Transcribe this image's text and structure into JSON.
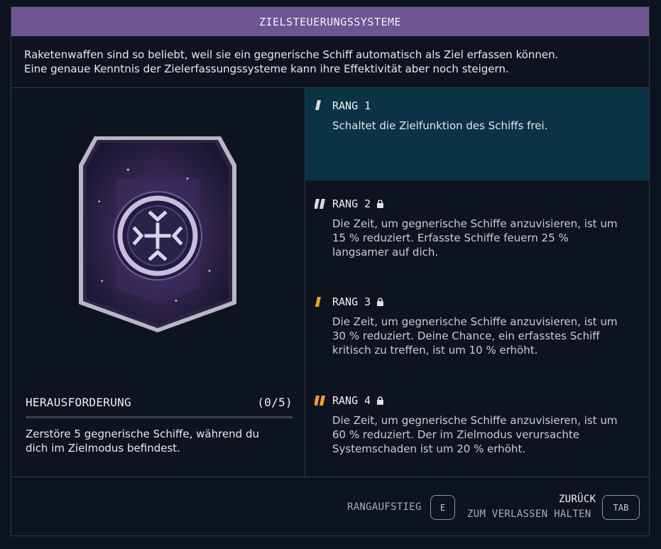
{
  "title": "ZIELSTEUERUNGSSYSTEME",
  "intro": {
    "line1": "Raketenwaffen sind so beliebt, weil sie ein gegnerische Schiff automatisch als Ziel erfassen können.",
    "line2": "Eine genaue Kenntnis der Zielerfassungssysteme kann ihre Effektivität aber noch steigern."
  },
  "challenge": {
    "label": "HERAUSFORDERUNG",
    "progress_text": "(0/5)",
    "progress_value": 0,
    "progress_max": 5,
    "desc_line1": "Zerstöre 5 gegnerische Schiffe, während du",
    "desc_line2": "dich im Zielmodus befindest."
  },
  "ranks": [
    {
      "label": "RANG 1",
      "locked": false,
      "active": true,
      "lines": [
        "Schaltet die Zielfunktion des Schiffs frei."
      ]
    },
    {
      "label": "RANG 2",
      "locked": true,
      "active": false,
      "lines": [
        "Die Zeit, um gegnerische Schiffe anzuvisieren, ist um",
        "15 % reduziert. Erfasste Schiffe feuern 25 %",
        "langsamer auf dich."
      ]
    },
    {
      "label": "RANG 3",
      "locked": true,
      "active": false,
      "lines": [
        "Die Zeit, um gegnerische Schiffe anzuvisieren, ist um",
        "30 % reduziert. Deine Chance, ein erfasstes Schiff",
        "kritisch zu treffen, ist um 10 % erhöht."
      ]
    },
    {
      "label": "RANG 4",
      "locked": true,
      "active": false,
      "lines": [
        "Die Zeit, um gegnerische Schiffe anzuvisieren, ist um",
        "60 % reduziert. Der im Zielmodus verursachte",
        "Systemschaden ist um 20 % erhöht."
      ]
    }
  ],
  "footer": {
    "rank_up_label": "RANGAUFSTIEG",
    "rank_up_key": "E",
    "back_label": "ZURÜCK",
    "hold_label": "ZUM VERLASSEN HALTEN",
    "back_key": "TAB"
  },
  "colors": {
    "title_bar": "#6e5690",
    "active_rank_bg": "#0c3246",
    "rank_marker_white": "#d7d9de",
    "rank_marker_orange": "#f0a020",
    "panel_bg": "#0d1420"
  },
  "icons": {
    "badge": "targeting-crosshair-badge-icon",
    "lock": "lock-icon",
    "rank_marker": "rank-tier-icon"
  }
}
